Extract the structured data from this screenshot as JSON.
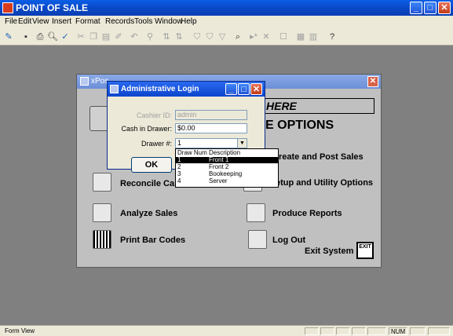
{
  "app": {
    "title": "POINT OF SALE"
  },
  "menu": [
    "File",
    "Edit",
    "View",
    "Insert",
    "Format",
    "Records",
    "Tools",
    "Window",
    "Help"
  ],
  "toolbar": [
    "design-view",
    "save",
    "print",
    "print-preview",
    "spell-check",
    "cut",
    "copy",
    "paste",
    "format-painter",
    "undo",
    "hyperlink",
    "sort-ascending",
    "sort-descending",
    "filter-by-selection",
    "filter-by-form",
    "apply-filter",
    "find",
    "new-record",
    "delete-record",
    "properties",
    "database-window",
    "new-object",
    "help"
  ],
  "switchboard": {
    "title": "xPos",
    "click_here": "HERE",
    "options_heading": "E OPTIONS",
    "options": [
      {
        "label": "reate and Post Sales",
        "icon": "register-icon"
      },
      {
        "label": "Reconcile Cash",
        "icon": "reconcile-icon"
      },
      {
        "label": "etup and Utility Options",
        "icon": "setup-icon"
      },
      {
        "label": "Analyze Sales",
        "icon": "analyze-icon"
      },
      {
        "label": "Produce Reports",
        "icon": "report-icon"
      },
      {
        "label": "Print Bar Codes",
        "icon": "barcode-icon"
      },
      {
        "label": "Log Out",
        "icon": "logout-icon"
      }
    ],
    "exit_label": "Exit System",
    "exit_icon_text": "EXIT"
  },
  "login": {
    "title": "Administrative Login",
    "cashier_label": "Cashier ID:",
    "cashier_value": "admin",
    "cash_label": "Cash in Drawer:",
    "cash_value": "$0.00",
    "drawer_label": "Drawer #:",
    "drawer_value": "1",
    "ok_label": "OK"
  },
  "drawer_list": {
    "headers": [
      "Draw Num",
      "Description"
    ],
    "rows": [
      {
        "num": "1",
        "desc": "Front 1",
        "selected": true
      },
      {
        "num": "2",
        "desc": "Front 2",
        "selected": false
      },
      {
        "num": "3",
        "desc": "Bookeeping",
        "selected": false
      },
      {
        "num": "4",
        "desc": "Server",
        "selected": false
      }
    ]
  },
  "status": {
    "left": "Form View",
    "num": "NUM"
  }
}
